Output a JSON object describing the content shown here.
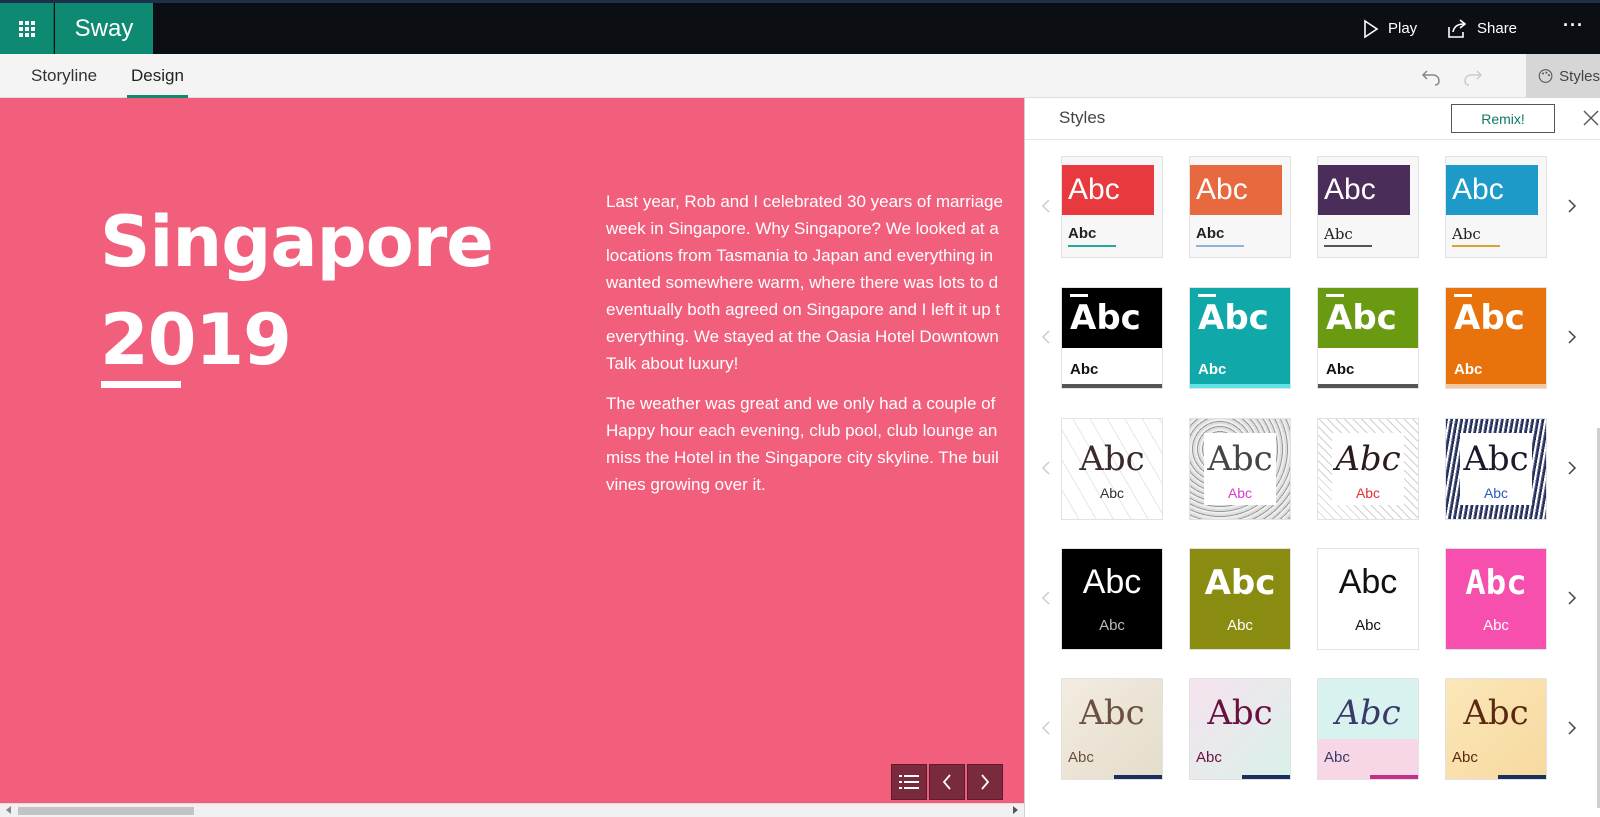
{
  "app": {
    "name": "Sway"
  },
  "header": {
    "play_label": "Play",
    "share_label": "Share",
    "more_label": "···"
  },
  "tabs": [
    {
      "label": "Storyline",
      "active": false
    },
    {
      "label": "Design",
      "active": true
    }
  ],
  "toolbar": {
    "styles_label": "Styles"
  },
  "story": {
    "title_line1": "Singapore",
    "title_line2": "2019",
    "background_color": "#f25f7d",
    "paragraph1_lines": [
      "Last year, Rob and I celebrated 30 years of marriage",
      "week in Singapore. Why Singapore? We looked at a",
      "locations from Tasmania to Japan and everything in",
      "wanted somewhere warm, where there was lots to d",
      "eventually both agreed on Singapore and I left it up t",
      "everything. We stayed at the Oasia Hotel Downtown",
      "Talk about luxury!"
    ],
    "paragraph2_lines": [
      "The weather was great and we only had a couple of",
      "Happy hour each evening, club pool, club lounge an",
      "miss the Hotel in the Singapore city skyline. The buil",
      "vines growing over it."
    ]
  },
  "styles_panel": {
    "title": "Styles",
    "remix_label": "Remix!",
    "rows": [
      {
        "tiles": [
          {
            "big": "Abc",
            "small": "Abc",
            "color": "#e8393f",
            "line": "#2aa79b"
          },
          {
            "big": "Abc",
            "small": "Abc",
            "color": "#e8683f",
            "line": "#8fb2d8"
          },
          {
            "big": "Abc",
            "small": "Abc",
            "color": "#4b2d59",
            "line": "#555555"
          },
          {
            "big": "Abc",
            "small": "Abc",
            "color": "#1e9ac8",
            "line": "#d9a23a"
          }
        ]
      },
      {
        "tiles": [
          {
            "big": "Abc",
            "small": "Abc",
            "color": "#000000",
            "small_color": "#111111",
            "bottom_bg": "#ffffff",
            "bar": "#555555"
          },
          {
            "big": "Abc",
            "small": "Abc",
            "color": "#10a8a8",
            "small_color": "#ffffff",
            "bottom_bg": "#10a8a8",
            "bar": "#5fe3e3"
          },
          {
            "big": "Abc",
            "small": "Abc",
            "color": "#6a9a12",
            "small_color": "#111111",
            "bottom_bg": "#ffffff",
            "bar": "#555555"
          },
          {
            "big": "Abc",
            "small": "Abc",
            "color": "#e8720c",
            "small_color": "#ffffff",
            "bottom_bg": "#e8720c",
            "bar": "#f6c8a0"
          }
        ]
      },
      {
        "tiles": [
          {
            "big": "Abc",
            "small": "Abc",
            "accent": "#2aa34a"
          },
          {
            "big": "Abc",
            "small": "Abc",
            "accent": "#d63cc8"
          },
          {
            "big": "Abc",
            "small": "Abc",
            "accent": "#e0303a"
          },
          {
            "big": "Abc",
            "small": "Abc",
            "accent": "#2a5db5"
          }
        ]
      },
      {
        "tiles": [
          {
            "big": "Abc",
            "small": "Abc",
            "bg": "#000000",
            "fg": "#ffffff",
            "small_fg": "#bbbbbb"
          },
          {
            "big": "Abc",
            "small": "Abc",
            "bg": "#8a8c12",
            "fg": "#ffffff",
            "small_fg": "#ffffff"
          },
          {
            "big": "Abc",
            "small": "Abc",
            "bg": "#ffffff",
            "fg": "#111111",
            "small_fg": "#111111"
          },
          {
            "big": "Abc",
            "small": "Abc",
            "bg": "#f64fae",
            "fg": "#ffffff",
            "small_fg": "#ffffff"
          }
        ]
      },
      {
        "tiles": [
          {
            "big": "Abc",
            "small": "Abc",
            "bg": "#f3ece0",
            "fg": "#6a5040",
            "accent": "#b07a4a"
          },
          {
            "big": "Abc",
            "small": "Abc",
            "bg": "#f6e3ee",
            "fg": "#6a1040",
            "accent": "#b01070"
          },
          {
            "big": "Abc",
            "small": "Abc",
            "bg": "#d8f3ef",
            "fg": "#3a3a6a",
            "accent": "#c0308a"
          },
          {
            "big": "Abc",
            "small": "Abc",
            "bg": "#fbe7b8",
            "fg": "#5a2a10",
            "accent": "#d0502a"
          }
        ]
      }
    ]
  }
}
